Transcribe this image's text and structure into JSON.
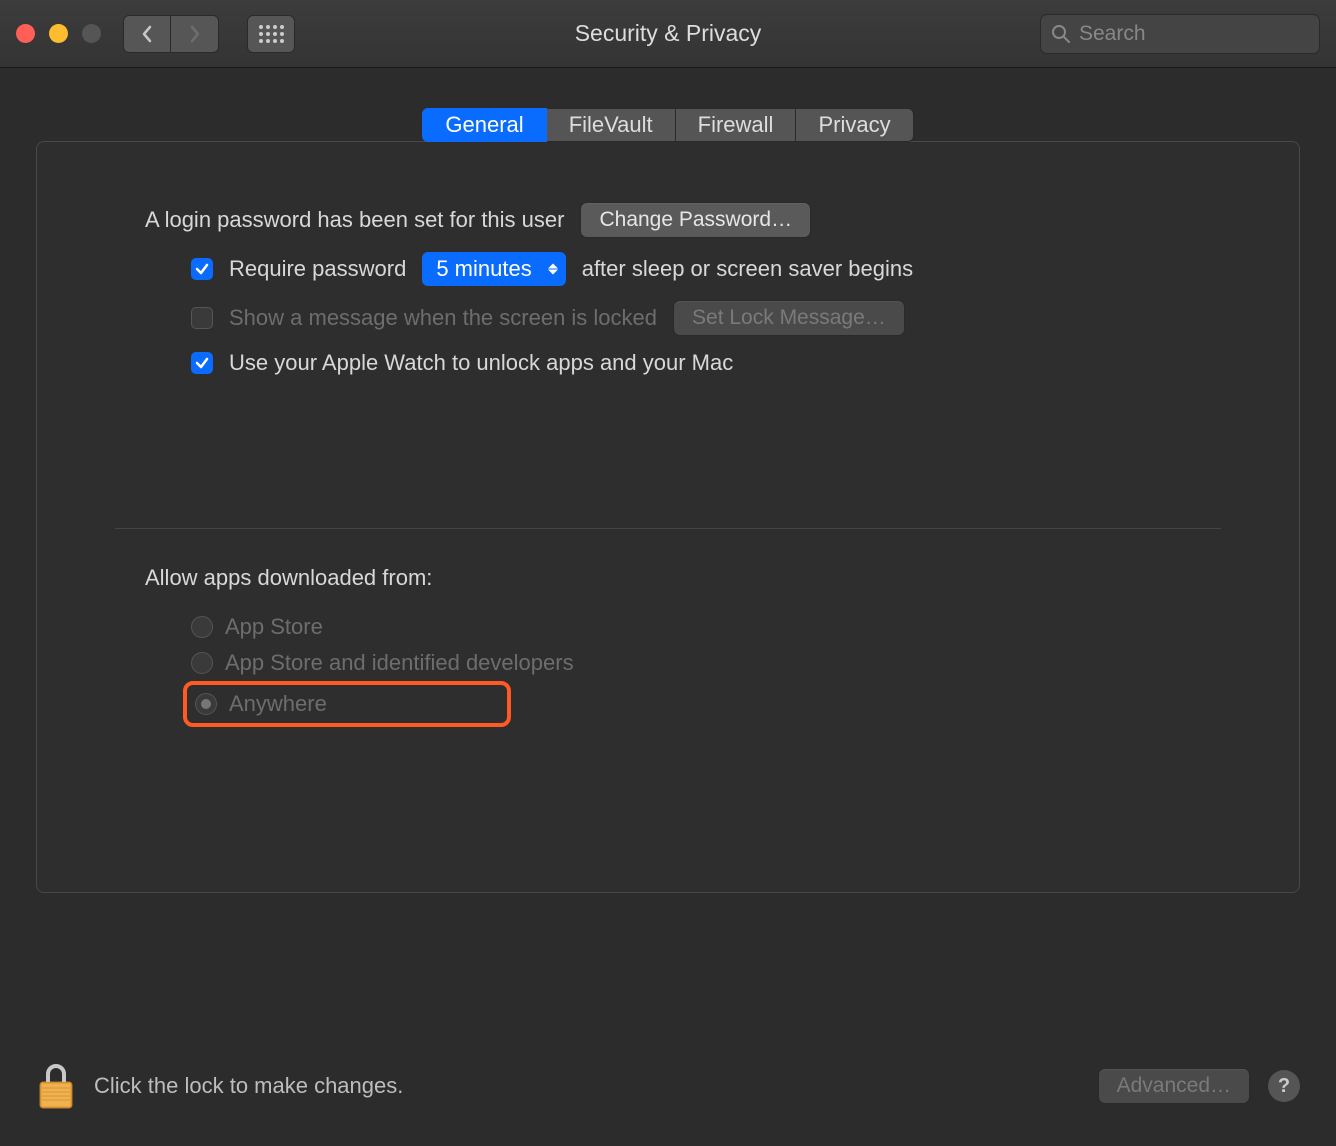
{
  "window": {
    "title": "Security & Privacy",
    "search_placeholder": "Search"
  },
  "tabs": {
    "general": "General",
    "filevault": "FileVault",
    "firewall": "Firewall",
    "privacy": "Privacy",
    "active": "general"
  },
  "general": {
    "password_set_text": "A login password has been set for this user",
    "change_password_btn": "Change Password…",
    "require_password_label": "Require password",
    "require_password_delay": "5 minutes",
    "require_password_suffix": "after sleep or screen saver begins",
    "show_message_label": "Show a message when the screen is locked",
    "set_lock_message_btn": "Set Lock Message…",
    "apple_watch_label": "Use your Apple Watch to unlock apps and your Mac",
    "allow_apps_heading": "Allow apps downloaded from:",
    "radio_app_store": "App Store",
    "radio_identified": "App Store and identified developers",
    "radio_anywhere": "Anywhere",
    "selected_radio": "anywhere"
  },
  "footer": {
    "lock_text": "Click the lock to make changes.",
    "advanced_btn": "Advanced…",
    "help": "?"
  }
}
